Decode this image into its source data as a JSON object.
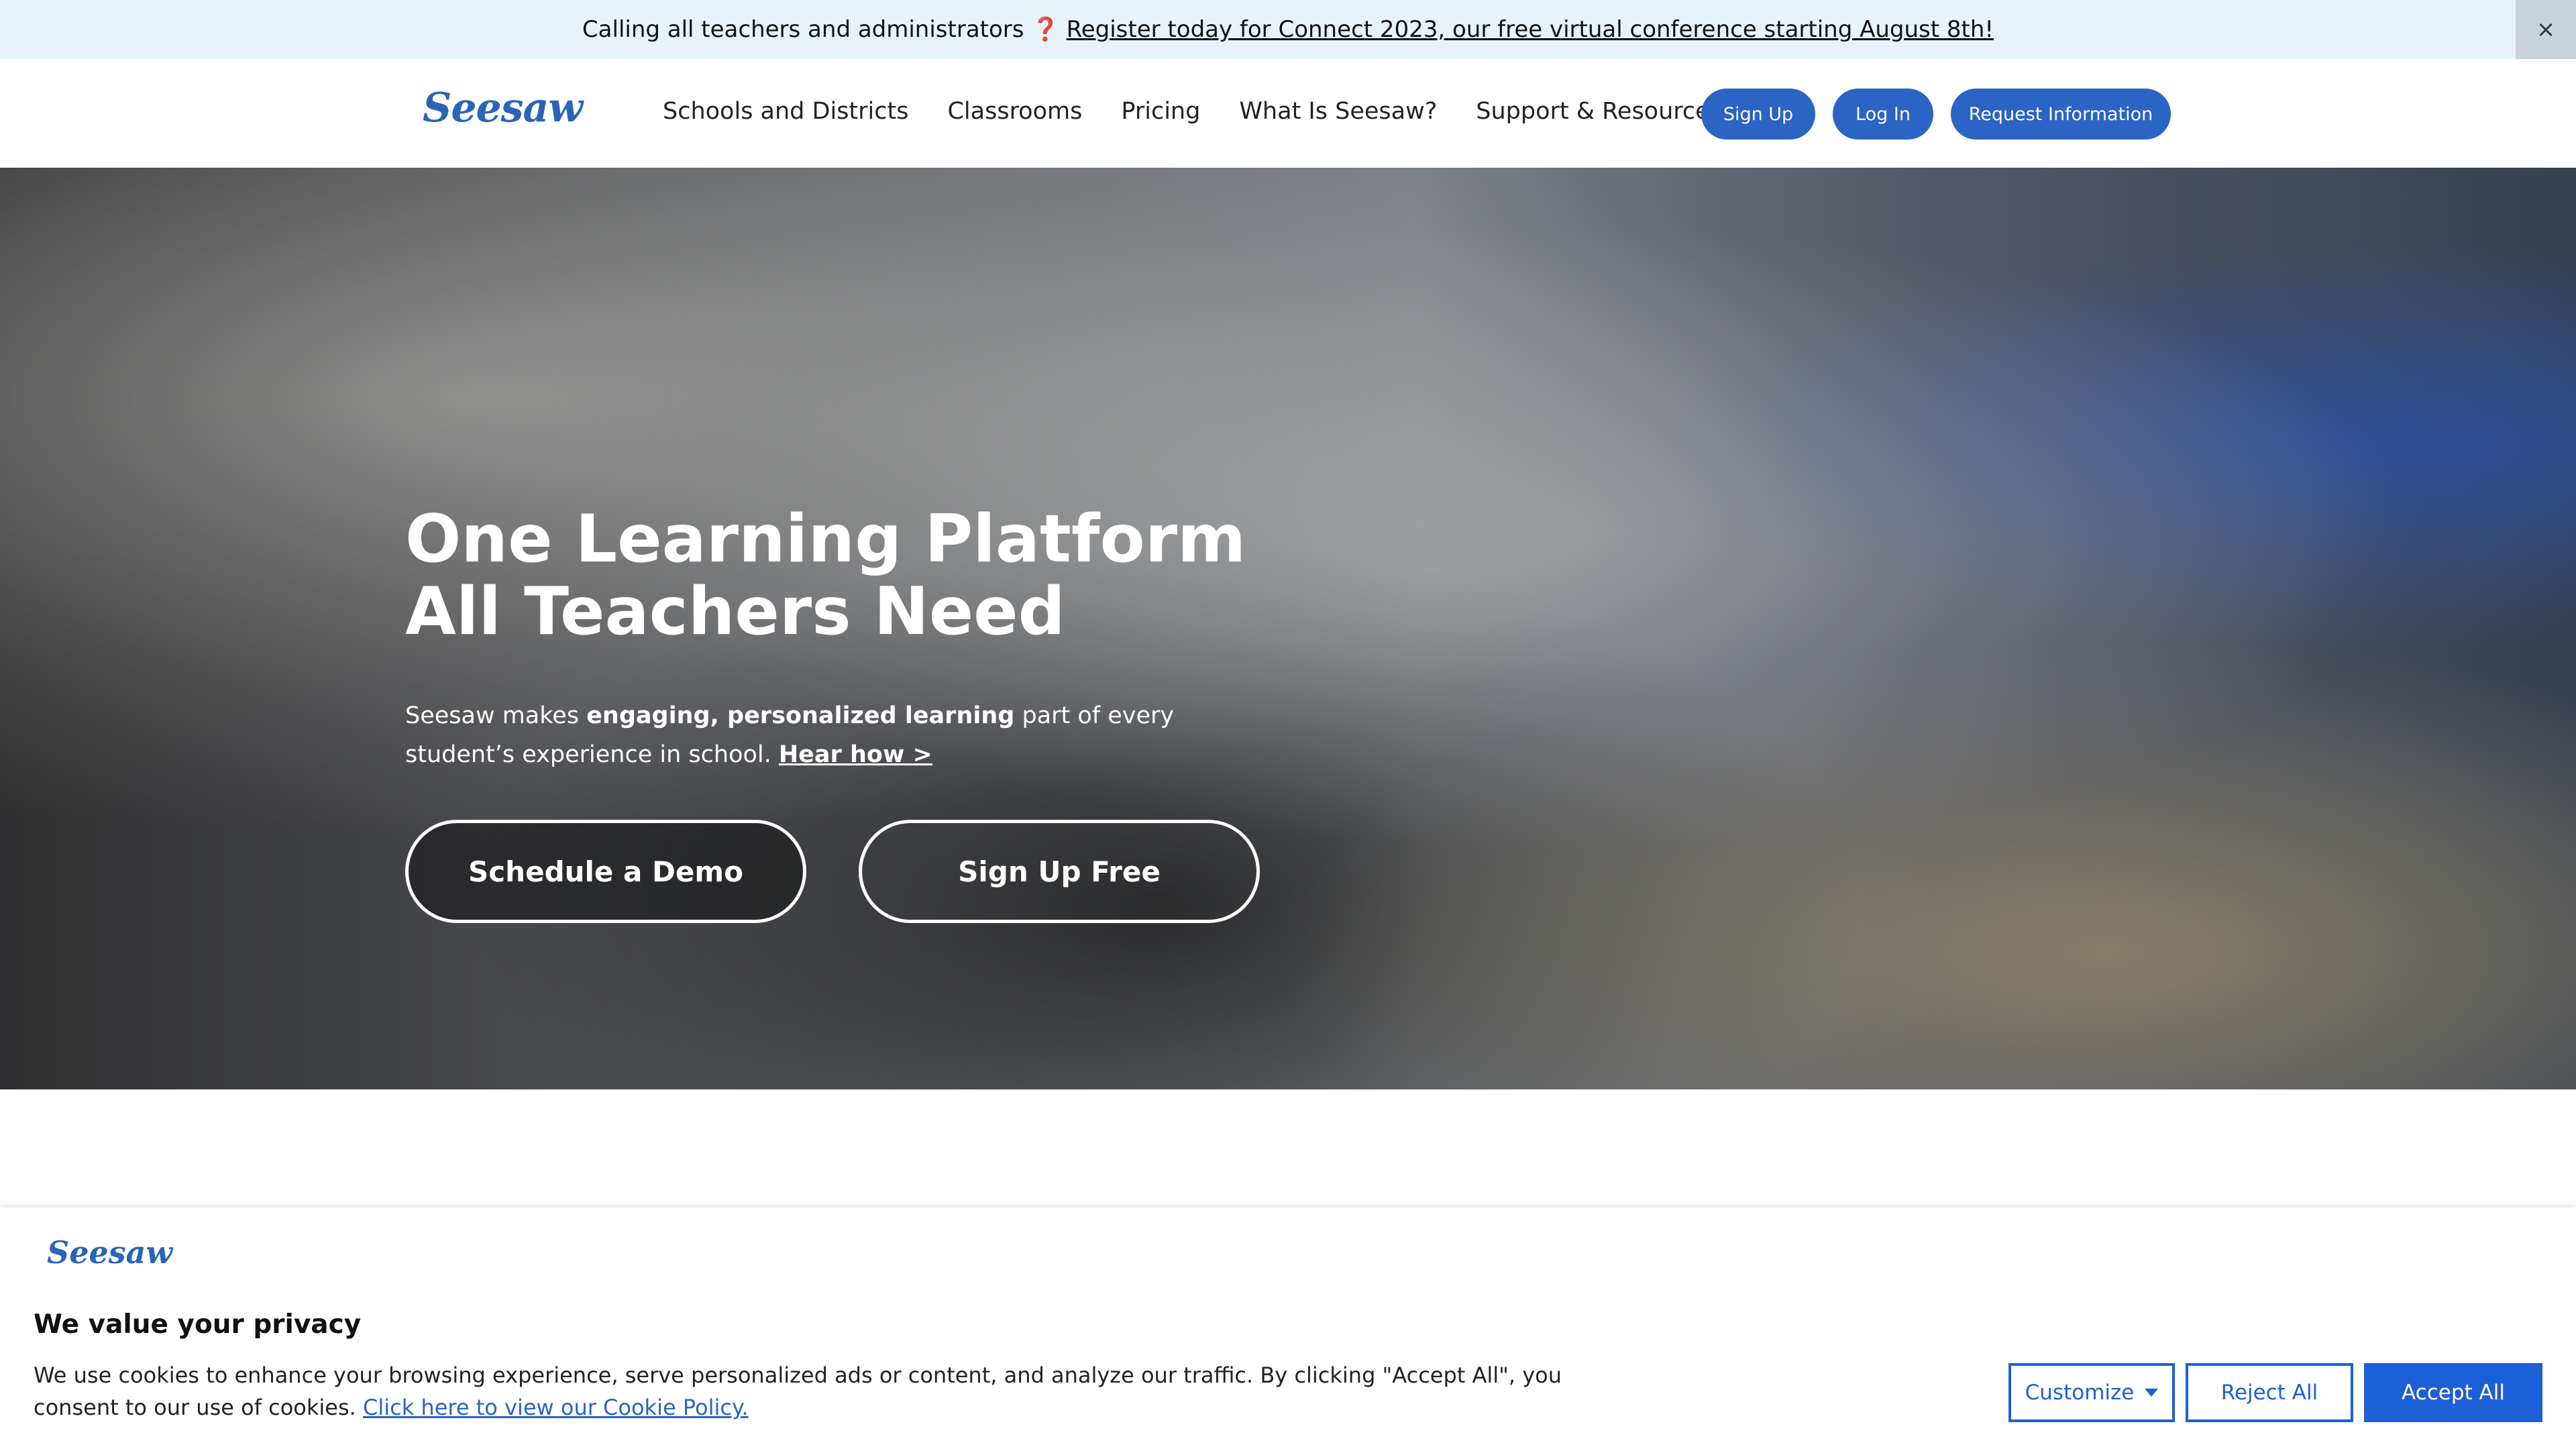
{
  "announcement": {
    "lead": "Calling all teachers and administrators ❓",
    "link": "Register today for Connect 2023, our free virtual conference starting August 8th!",
    "close": "×"
  },
  "header": {
    "logo": "Seesaw",
    "nav": [
      "Schools and Districts",
      "Classrooms",
      "Pricing",
      "What Is Seesaw?",
      "Support & Resources"
    ],
    "signup": "Sign Up",
    "login": "Log In",
    "request": "Request Information"
  },
  "hero": {
    "title": "One Learning Platform All Teachers Need",
    "sub_before": "Seesaw makes ",
    "sub_bold": "engaging, personalized learning",
    "sub_after": " part of every student’s experience in school. ",
    "sub_link": "Hear how >",
    "demo": "Schedule a Demo",
    "signup_free": "Sign Up Free"
  },
  "cookie": {
    "logo": "Seesaw",
    "title": "We value your privacy",
    "message": "We use cookies to enhance your browsing experience, serve personalized ads or content, and analyze our traffic. By clicking \"Accept All\", you consent to our use of cookies. ",
    "policy_link": "Click here to view our Cookie Policy.",
    "customize": "Customize",
    "reject": "Reject All",
    "accept": "Accept All"
  },
  "colors": {
    "brand": "#2a64c4",
    "banner": "#e6f4fa",
    "cookie_accent": "#1d5fd6"
  }
}
